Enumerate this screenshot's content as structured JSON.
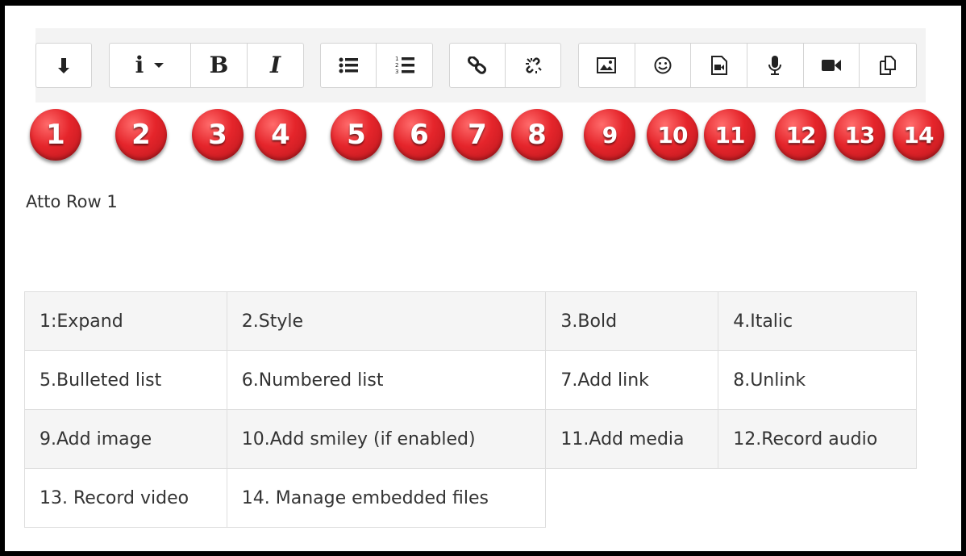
{
  "toolbar": {
    "background": "#f3f3f3",
    "groups": [
      {
        "buttons": [
          {
            "label": "",
            "icon": "expand-arrow-icon"
          }
        ]
      },
      {
        "buttons": [
          {
            "label": "i",
            "icon": "style-icon"
          }
        ]
      },
      {
        "buttons": [
          {
            "label": "B",
            "icon": "bold-icon"
          },
          {
            "label": "I",
            "icon": "italic-icon"
          }
        ]
      },
      {
        "buttons": [
          {
            "label": "",
            "icon": "bulleted-list-icon"
          },
          {
            "label": "",
            "icon": "numbered-list-icon"
          }
        ]
      },
      {
        "buttons": [
          {
            "label": "",
            "icon": "link-icon"
          },
          {
            "label": "",
            "icon": "unlink-icon"
          }
        ]
      },
      {
        "buttons": [
          {
            "label": "",
            "icon": "image-icon"
          },
          {
            "label": "",
            "icon": "smiley-icon"
          },
          {
            "label": "",
            "icon": "media-icon"
          },
          {
            "label": "",
            "icon": "microphone-icon"
          },
          {
            "label": "",
            "icon": "video-camera-icon"
          },
          {
            "label": "",
            "icon": "embedded-files-icon"
          }
        ]
      }
    ]
  },
  "badges": [
    "1",
    "2",
    "3",
    "4",
    "5",
    "6",
    "7",
    "8",
    "9",
    "10",
    "11",
    "12",
    "13",
    "14"
  ],
  "badge_color": "#e5252b",
  "row_label": "Atto Row 1",
  "legend": {
    "rows": [
      [
        "1:Expand",
        "2.Style",
        "3.Bold",
        "4.Italic"
      ],
      [
        "5.Bulleted list",
        "6.Numbered list",
        "7.Add link",
        "8.Unlink"
      ],
      [
        "9.Add image",
        "10.Add smiley (if enabled)",
        "11.Add media",
        "12.Record audio"
      ],
      [
        "13. Record video",
        "14. Manage embedded files",
        "",
        ""
      ]
    ]
  }
}
